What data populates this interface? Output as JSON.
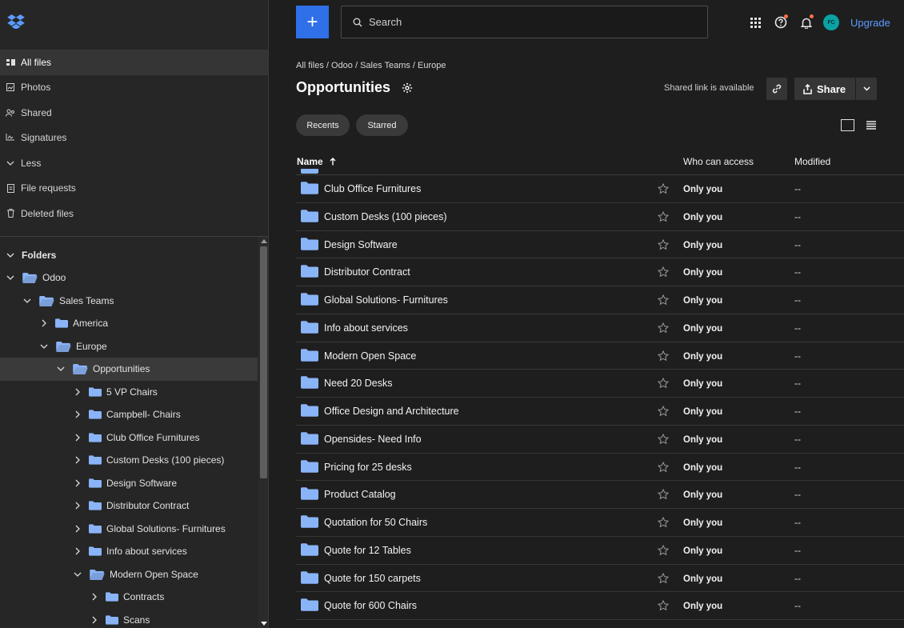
{
  "sidebar": {
    "nav": [
      {
        "label": "All files",
        "icon": "all-files-icon",
        "active": true
      },
      {
        "label": "Photos",
        "icon": "photos-icon"
      },
      {
        "label": "Shared",
        "icon": "shared-icon"
      },
      {
        "label": "Signatures",
        "icon": "signatures-icon"
      },
      {
        "label": "Less",
        "icon": "chevron-down-icon"
      },
      {
        "label": "File requests",
        "icon": "file-requests-icon"
      },
      {
        "label": "Deleted files",
        "icon": "trash-icon"
      }
    ],
    "folders_heading": "Folders",
    "tree": [
      {
        "label": "Odoo",
        "level": 0,
        "open": true
      },
      {
        "label": "Sales Teams",
        "level": 1,
        "open": true
      },
      {
        "label": "America",
        "level": 2,
        "open": false
      },
      {
        "label": "Europe",
        "level": 2,
        "open": true
      },
      {
        "label": "Opportunities",
        "level": 3,
        "open": true,
        "selected": true
      },
      {
        "label": "5 VP Chairs",
        "level": 4,
        "open": false
      },
      {
        "label": "Campbell- Chairs",
        "level": 4,
        "open": false
      },
      {
        "label": "Club Office Furnitures",
        "level": 4,
        "open": false
      },
      {
        "label": "Custom Desks (100 pieces)",
        "level": 4,
        "open": false
      },
      {
        "label": "Design Software",
        "level": 4,
        "open": false
      },
      {
        "label": "Distributor Contract",
        "level": 4,
        "open": false
      },
      {
        "label": "Global Solutions- Furnitures",
        "level": 4,
        "open": false
      },
      {
        "label": "Info about services",
        "level": 4,
        "open": false
      },
      {
        "label": "Modern Open Space",
        "level": 4,
        "open": true
      },
      {
        "label": "Contracts",
        "level": 5,
        "open": false
      },
      {
        "label": "Scans",
        "level": 5,
        "open": false
      }
    ]
  },
  "header": {
    "new_button": "+",
    "search_placeholder": "Search",
    "avatar_initials": "FC",
    "upgrade_label": "Upgrade"
  },
  "breadcrumb": "All files / Odoo / Sales Teams / Europe",
  "page_title": "Opportunities",
  "shared_link_text": "Shared link is available",
  "share_label": "Share",
  "filters": [
    "Recents",
    "Starred"
  ],
  "table": {
    "col_name": "Name",
    "col_who": "Who can access",
    "col_modified": "Modified",
    "rows": [
      {
        "name": "Club Office Furnitures",
        "access": "Only you",
        "modified": "--"
      },
      {
        "name": "Custom Desks (100 pieces)",
        "access": "Only you",
        "modified": "--"
      },
      {
        "name": "Design Software",
        "access": "Only you",
        "modified": "--"
      },
      {
        "name": "Distributor Contract",
        "access": "Only you",
        "modified": "--"
      },
      {
        "name": "Global Solutions- Furnitures",
        "access": "Only you",
        "modified": "--"
      },
      {
        "name": "Info about services",
        "access": "Only you",
        "modified": "--"
      },
      {
        "name": "Modern Open Space",
        "access": "Only you",
        "modified": "--"
      },
      {
        "name": "Need 20 Desks",
        "access": "Only you",
        "modified": "--"
      },
      {
        "name": "Office Design and Architecture",
        "access": "Only you",
        "modified": "--"
      },
      {
        "name": "Opensides- Need Info",
        "access": "Only you",
        "modified": "--"
      },
      {
        "name": "Pricing for 25 desks",
        "access": "Only you",
        "modified": "--"
      },
      {
        "name": "Product Catalog",
        "access": "Only you",
        "modified": "--"
      },
      {
        "name": "Quotation for 50 Chairs",
        "access": "Only you",
        "modified": "--"
      },
      {
        "name": "Quote for 12 Tables",
        "access": "Only you",
        "modified": "--"
      },
      {
        "name": "Quote for 150 carpets",
        "access": "Only you",
        "modified": "--"
      },
      {
        "name": "Quote for 600 Chairs",
        "access": "Only you",
        "modified": "--"
      }
    ]
  },
  "colors": {
    "accent": "#2f6fe8",
    "folder": "#8ab4f8",
    "link": "#5b9bff",
    "notification": "#ff7043",
    "avatar": "#0aa3a3"
  }
}
